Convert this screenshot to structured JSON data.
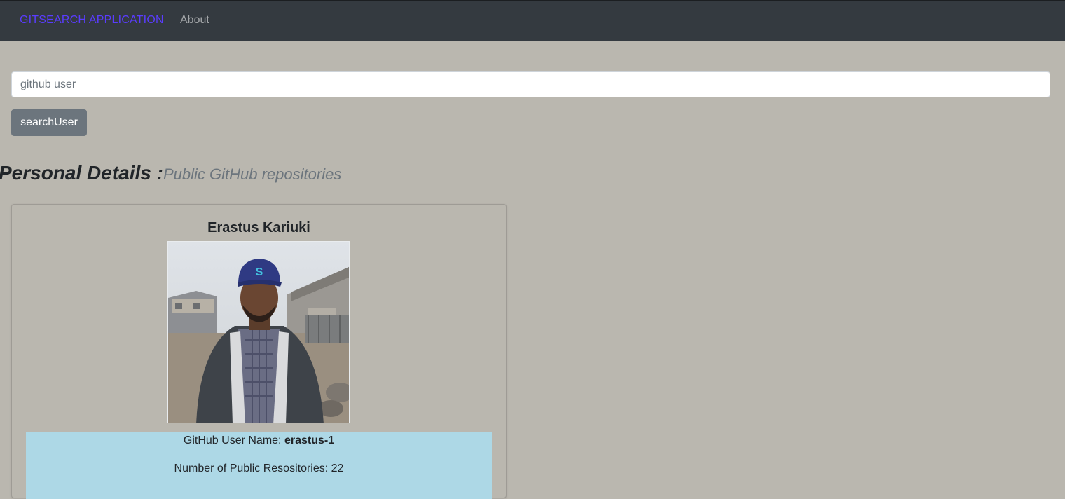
{
  "navbar": {
    "brand": "GITSEARCH APPLICATION",
    "about": "About",
    "brand_color": "#5a3cff",
    "background": "#343a40"
  },
  "search": {
    "placeholder": "github user",
    "value": "",
    "button_label": "searchUser"
  },
  "section": {
    "title": "Personal Details :",
    "subtitle": "Public GitHub repositories"
  },
  "profile": {
    "name": "Erastus Kariuki",
    "avatar_alt": "Erastus Kariuki",
    "username_label": "GitHub User Name: ",
    "username": "erastus-1",
    "repos_label": "Number of Public Resositories: ",
    "repos_count": "22",
    "panel_color": "#add8e6"
  },
  "page": {
    "background": "#bab7af"
  }
}
